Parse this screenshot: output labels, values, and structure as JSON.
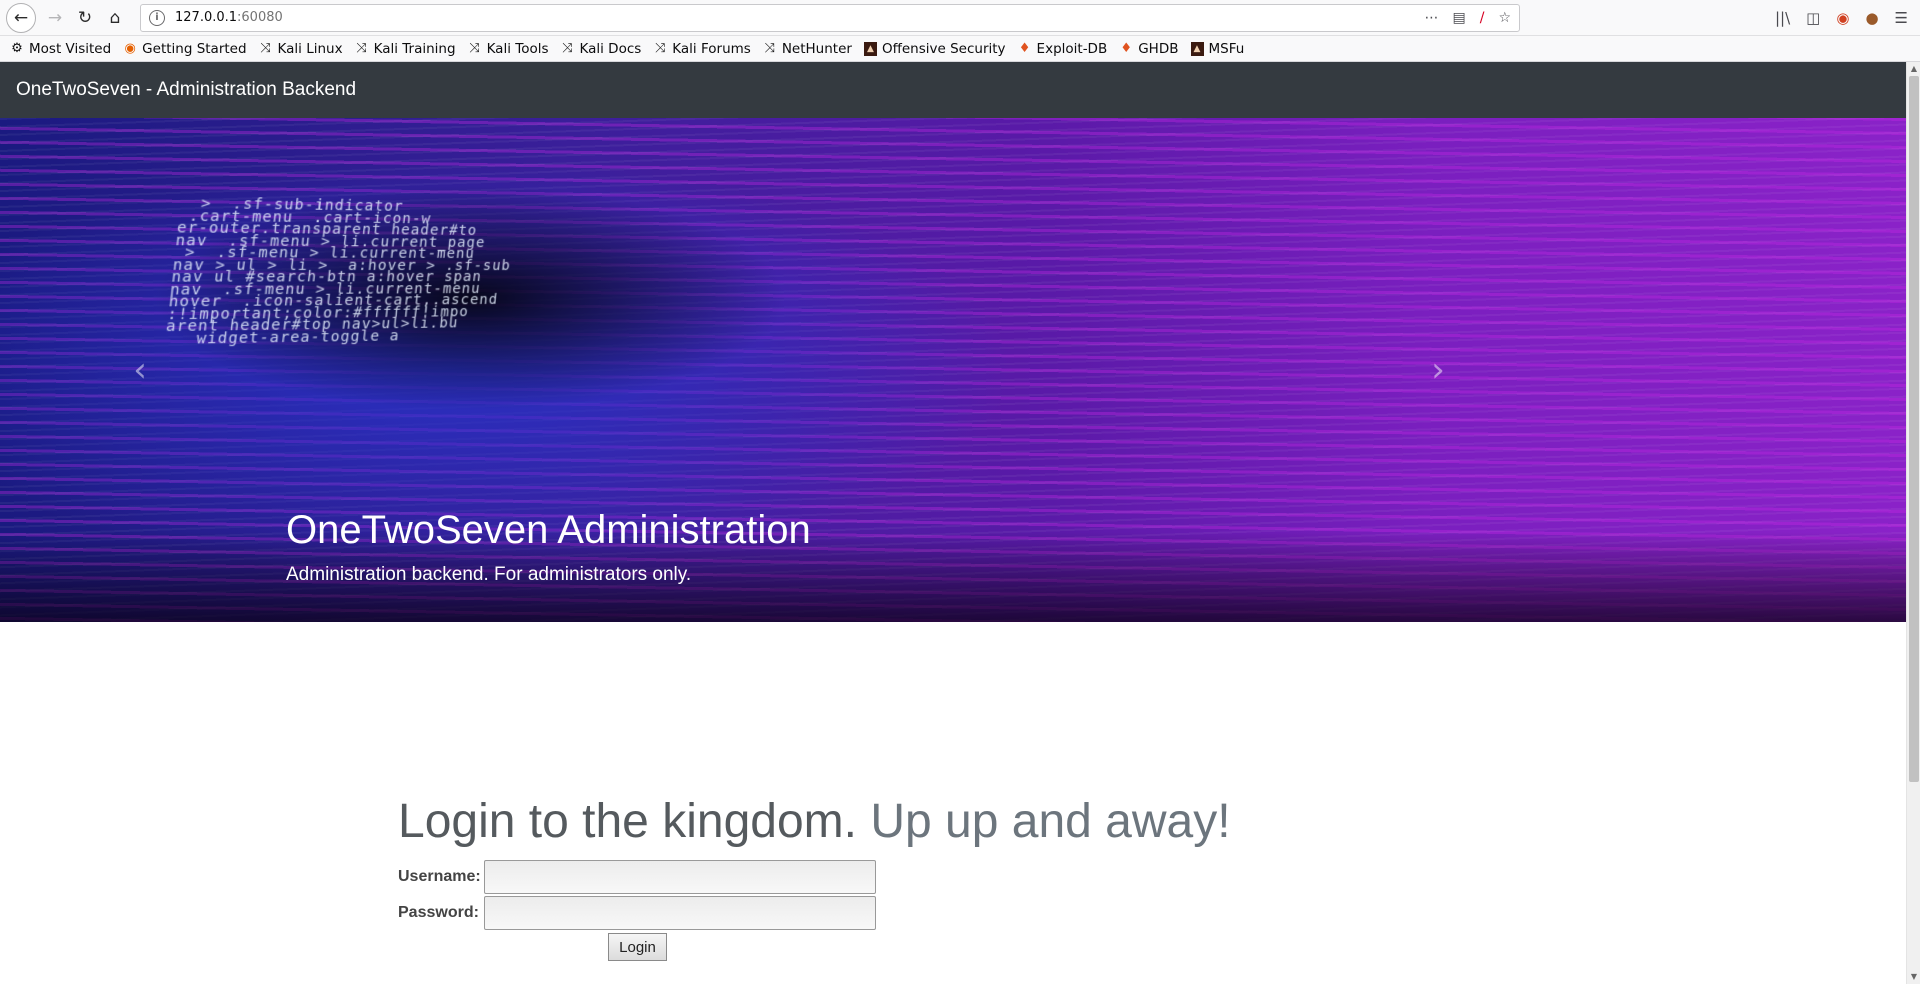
{
  "browser": {
    "url_host": "127.0.0.1",
    "url_port": ":60080",
    "bookmarks": [
      {
        "label": "Most Visited",
        "icon": "gear-icon"
      },
      {
        "label": "Getting Started",
        "icon": "firefox-icon"
      },
      {
        "label": "Kali Linux",
        "icon": "kali-dragon-icon"
      },
      {
        "label": "Kali Training",
        "icon": "kali-dragon-icon"
      },
      {
        "label": "Kali Tools",
        "icon": "kali-dragon-icon"
      },
      {
        "label": "Kali Docs",
        "icon": "kali-dragon-icon"
      },
      {
        "label": "Kali Forums",
        "icon": "kali-dragon-icon"
      },
      {
        "label": "NetHunter",
        "icon": "kali-dragon-icon"
      },
      {
        "label": "Offensive Security",
        "icon": "offsec-icon"
      },
      {
        "label": "Exploit-DB",
        "icon": "exploitdb-icon"
      },
      {
        "label": "GHDB",
        "icon": "exploitdb-icon"
      },
      {
        "label": "MSFu",
        "icon": "offsec-icon"
      }
    ]
  },
  "navbar": {
    "brand": "OneTwoSeven - Administration Backend"
  },
  "carousel": {
    "title": "OneTwoSeven Administration",
    "subtitle": "Administration backend. For administrators only."
  },
  "login": {
    "heading": "Login to the kingdom.",
    "heading_muted": "Up up and away!",
    "username_label": "Username:",
    "password_label": "Password:",
    "submit_label": "Login"
  }
}
